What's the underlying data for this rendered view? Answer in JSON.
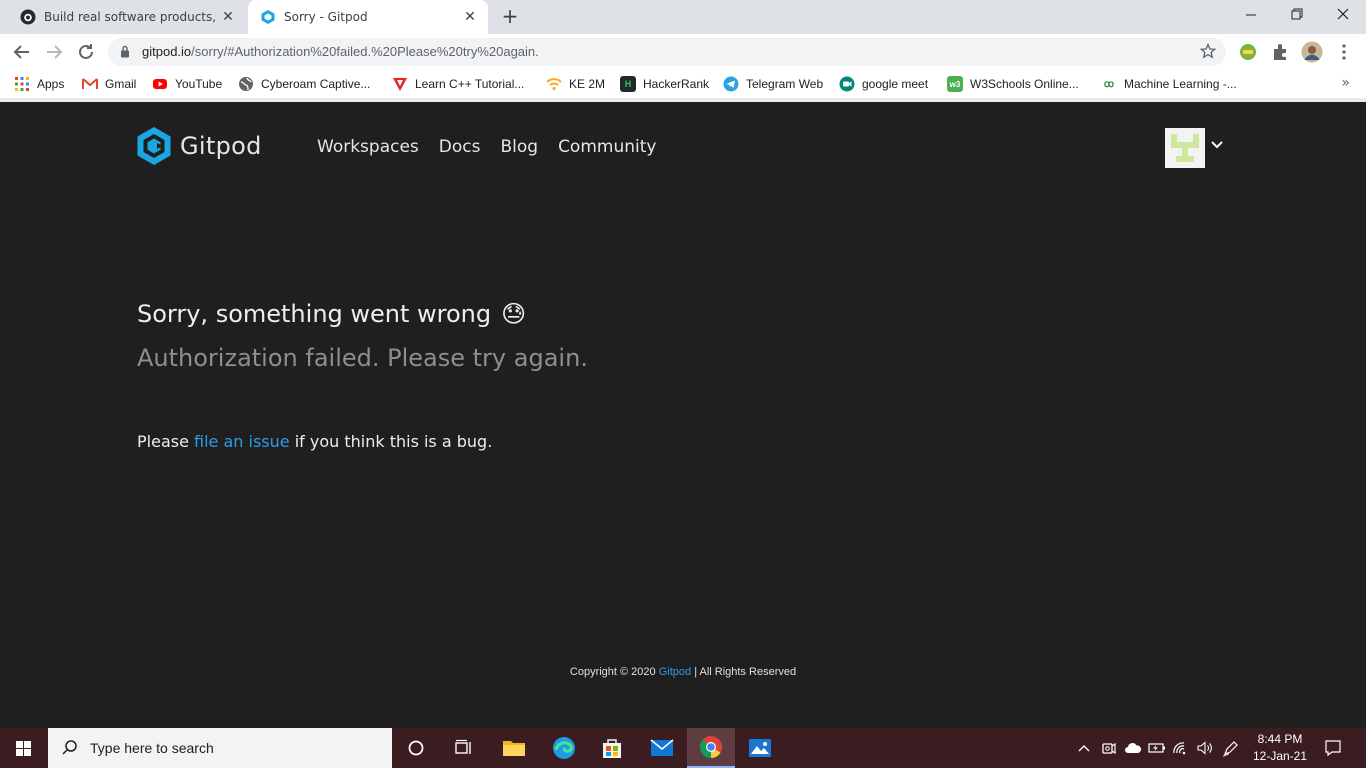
{
  "browser": {
    "tabs": [
      {
        "title": "Build real software products, Lear",
        "active": false
      },
      {
        "title": "Sorry - Gitpod",
        "active": true
      }
    ],
    "url": {
      "host": "gitpod.io",
      "path": "/sorry/#Authorization%20failed.%20Please%20try%20again."
    },
    "bookmarks": [
      {
        "label": "Apps",
        "icon": "apps-grid-icon"
      },
      {
        "label": "Gmail",
        "icon": "gmail-icon"
      },
      {
        "label": "YouTube",
        "icon": "youtube-icon"
      },
      {
        "label": "Cyberoam Captive...",
        "icon": "globe-icon"
      },
      {
        "label": "Learn C++ Tutorial...",
        "icon": "triangle-icon"
      },
      {
        "label": "KE 2M",
        "icon": "wifi-icon"
      },
      {
        "label": "HackerRank",
        "icon": "hackerrank-icon"
      },
      {
        "label": "Telegram Web",
        "icon": "telegram-icon"
      },
      {
        "label": "google meet",
        "icon": "meet-icon"
      },
      {
        "label": "W3Schools Online...",
        "icon": "w3schools-icon"
      },
      {
        "label": "Machine Learning -...",
        "icon": "ml-icon"
      }
    ]
  },
  "gitpod": {
    "brand": "Gitpod",
    "nav": [
      "Workspaces",
      "Docs",
      "Blog",
      "Community"
    ],
    "error": {
      "title": "Sorry, something went wrong",
      "emoji": "😓",
      "message": "Authorization failed. Please try again.",
      "note_prefix": "Please",
      "note_link": "file an issue",
      "note_suffix": "if you think this is a bug."
    },
    "footer": {
      "prefix": "Copyright © 2020",
      "link": "Gitpod",
      "suffix": "| All Rights Reserved"
    }
  },
  "taskbar": {
    "search_placeholder": "Type here to search",
    "time": "8:44 PM",
    "date": "12-Jan-21"
  },
  "colors": {
    "page_bg": "#1f1f1f",
    "link": "#2f9be8",
    "gitpod_blue": "#1aa6e4",
    "taskbar_bg": "#3b1c20"
  }
}
